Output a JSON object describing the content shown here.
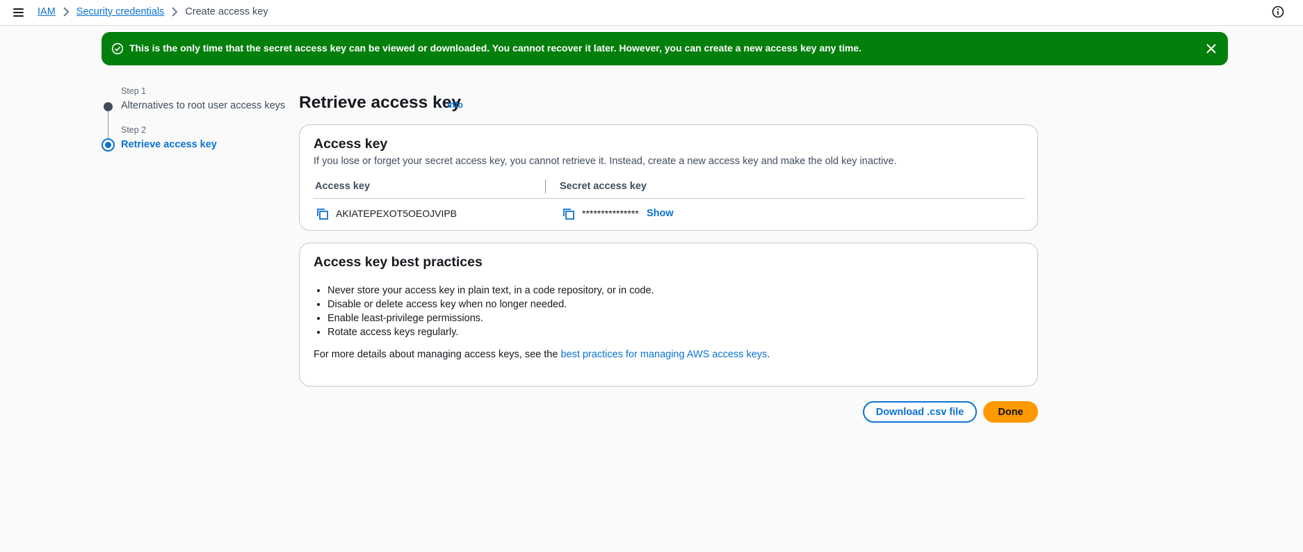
{
  "breadcrumb": {
    "items": [
      {
        "label": "IAM"
      },
      {
        "label": "Security credentials"
      },
      {
        "label": "Create access key"
      }
    ]
  },
  "flash": {
    "message": "This is the only time that the secret access key can be viewed or downloaded. You cannot recover it later. However, you can create a new access key any time.",
    "type": "success",
    "color": "#037f0c"
  },
  "steps": [
    {
      "step_label": "Step 1",
      "title": "Alternatives to root user access keys",
      "state": "completed"
    },
    {
      "step_label": "Step 2",
      "title": "Retrieve access key",
      "state": "active"
    }
  ],
  "page": {
    "title": "Retrieve access key",
    "info_link": "Info"
  },
  "access_key_card": {
    "title": "Access key",
    "description": "If you lose or forget your secret access key, you cannot retrieve it. Instead, create a new access key and make the old key inactive.",
    "columns": [
      "Access key",
      "Secret access key"
    ],
    "access_key_value": "AKIATEPEXOT5OEOJVIPB",
    "secret_masked": "***************",
    "show_label": "Show"
  },
  "best_practices": {
    "title": "Access key best practices",
    "items": [
      "Never store your access key in plain text, in a code repository, or in code.",
      "Disable or delete access key when no longer needed.",
      "Enable least-privilege permissions.",
      "Rotate access keys regularly."
    ],
    "footer_prefix": "For more details about managing access keys, see the",
    "footer_link": "best practices for managing AWS access keys",
    "footer_suffix": "."
  },
  "buttons": {
    "download_label": "Download .csv file",
    "done_label": "Done"
  },
  "colors": {
    "accent": "#0972d3",
    "primary_button": "#ff9900",
    "success": "#037f0c"
  },
  "icons": [
    "menu-icon",
    "chevron-right-icon",
    "info-circle-icon",
    "check-circle-icon",
    "close-icon",
    "copy-icon"
  ]
}
